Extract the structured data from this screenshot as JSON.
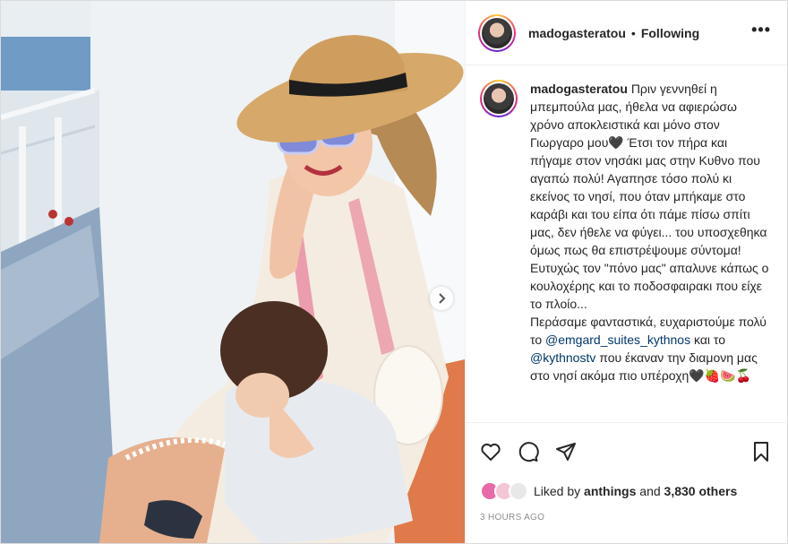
{
  "post": {
    "username": "madogasteratou",
    "separator": "•",
    "follow_status": "Following",
    "more_label": "•••",
    "caption": {
      "username": "madogasteratou",
      "text_part1": "Πριν γεννηθεί η μπεμπούλα μας, ήθελα να αφιερώσω χρόνο αποκλειστικά και μόνο στον Γιωργαρο μου🖤 Έτσι τον πήρα και πήγαμε στον νησάκι μας στην Κυθνο που αγαπώ πολύ! Αγαπησε τόσο πολύ κι εκείνος το νησί, που όταν μπήκαμε στο καράβι και του είπα ότι πάμε πίσω σπίτι μας, δεν ήθελε να φύγει... του υποσχεθηκα όμως πως θα επιστρέψουμε σύντομα! Ευτυχώς τον \"πόνο μας\" απαλυνε κάπως ο κουλοχέρης και το ποδοσφαιρακι που είχε το πλοίο...",
      "text_part2": "Περάσαμε φανταστικά, ευχαριστούμε πολύ το",
      "mention1": "@emgard_suites_kythnos",
      "text_part3": "και το",
      "mention2": "@kythnostv",
      "text_part4": "που έκαναν την διαμονη μας στο νησί ακόμα πιο υπέροχη🖤🍓🍉🍒"
    },
    "likes": {
      "prefix": "Liked by",
      "user": "anthings",
      "middle": "and",
      "count": "3,830 others"
    },
    "timestamp": "3 HOURS AGO"
  },
  "icons": {
    "like": "heart-icon",
    "comment": "comment-icon",
    "share": "paper-plane-icon",
    "save": "bookmark-icon",
    "next": "chevron-right-icon"
  },
  "colors": {
    "text": "#262626",
    "muted": "#8e8e8e",
    "mention": "#00376b",
    "border": "#dbdbdb"
  }
}
